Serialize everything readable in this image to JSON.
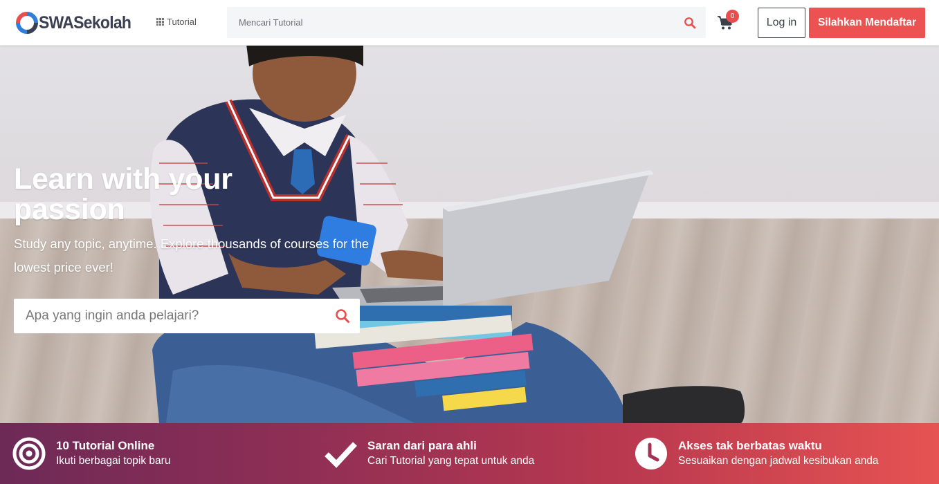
{
  "brand": {
    "name": "SWASekolah"
  },
  "nav": {
    "tutorial_label": "Tutorial",
    "search_placeholder": "Mencari Tutorial",
    "cart_count": "0",
    "login_label": "Log in",
    "register_label": "Silahkan Mendaftar"
  },
  "hero": {
    "title": "Learn with your passion",
    "subtitle": "Study any topic, anytime. Explore thousands of courses for the lowest price ever!",
    "search_placeholder": "Apa yang ingin anda pelajari?"
  },
  "features": [
    {
      "icon": "target-icon",
      "title": "10 Tutorial Online",
      "desc": "Ikuti berbagai topik baru"
    },
    {
      "icon": "check-icon",
      "title": "Saran dari para ahli",
      "desc": "Cari Tutorial yang tepat untuk anda"
    },
    {
      "icon": "clock-icon",
      "title": "Akses tak berbatas waktu",
      "desc": "Sesuaikan dengan jadwal kesibukan anda"
    }
  ],
  "colors": {
    "accent": "#ec5252",
    "dark": "#3b3f4a",
    "logo_blue": "#2f7fd6"
  }
}
